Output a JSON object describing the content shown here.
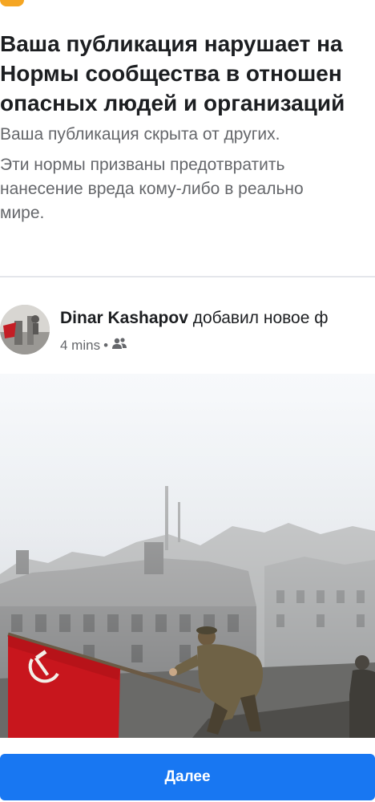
{
  "notice": {
    "title_lines": [
      "Ваша публикация нарушает на",
      "Нормы сообщества в отношен",
      "опасных людей и организаций"
    ],
    "subtitle": "Ваша публикация скрыта от других.",
    "description_lines": [
      "Эти нормы призваны предотвратить",
      "нанесение вреда кому-либо в реально",
      "мире."
    ]
  },
  "post": {
    "author": "Dinar Kashapov",
    "action": " добавил новое ф",
    "time": "4 mins",
    "separator": "•",
    "audience_icon": "friends-icon",
    "photo_icon": "flag-raising-photo"
  },
  "footer": {
    "next_label": "Далее"
  },
  "colors": {
    "accent": "#1877f2",
    "warning": "#f5a623",
    "text": "#1c1e21",
    "secondary": "#65676b"
  }
}
